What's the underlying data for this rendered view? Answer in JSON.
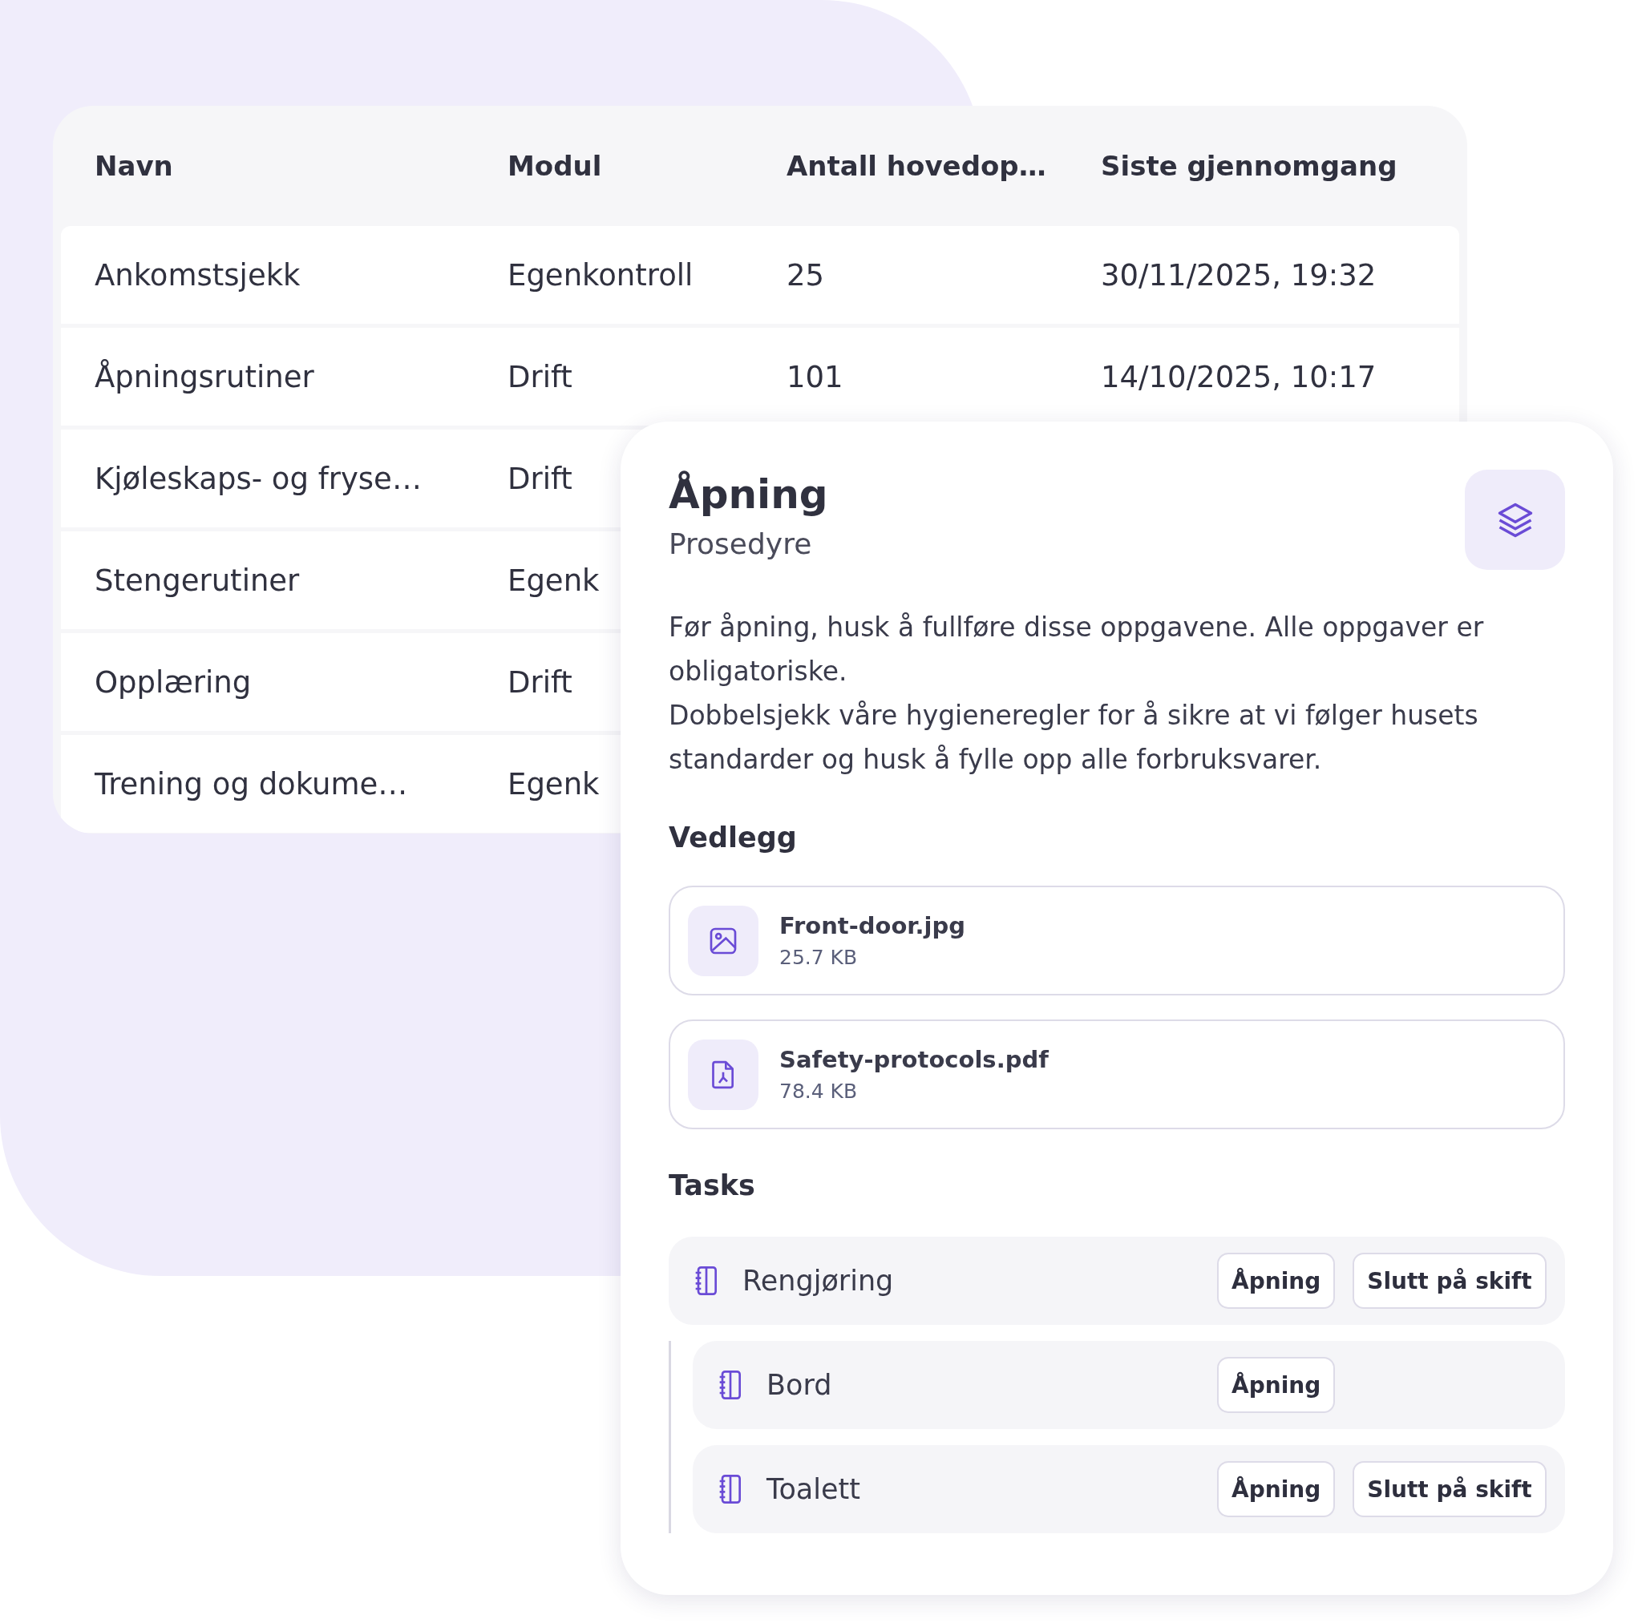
{
  "table": {
    "columns": [
      "Navn",
      "Modul",
      "Antall hovedop…",
      "Siste gjennomgang"
    ],
    "rows": [
      {
        "cells": [
          "Ankomstsjekk",
          "Egenkontroll",
          "25",
          "30/11/2025, 19:32"
        ]
      },
      {
        "cells": [
          "Åpningsrutiner",
          "Drift",
          "101",
          "14/10/2025, 10:17"
        ]
      },
      {
        "cells": [
          "Kjøleskaps- og fryse…",
          "Drift"
        ]
      },
      {
        "cells": [
          "Stengerutiner",
          "Egenk"
        ]
      },
      {
        "cells": [
          "Opplæring",
          "Drift"
        ]
      },
      {
        "cells": [
          "Trening og dokume…",
          "Egenk"
        ]
      }
    ]
  },
  "detail": {
    "title": "Åpning",
    "subtitle": "Prosedyre",
    "description": [
      "Før åpning, husk å fullføre disse oppgavene. Alle oppgaver er obligatoriske.",
      "Dobbelsjekk våre hygieneregler for å sikre at vi følger husets standarder og husk å fylle opp alle forbruksvarer."
    ],
    "attachments_heading": "Vedlegg",
    "attachments": [
      {
        "kind": "image",
        "name": "Front-door.jpg",
        "size": "25.7 KB"
      },
      {
        "kind": "pdf",
        "name": "Safety-protocols.pdf",
        "size": "78.4 KB"
      }
    ],
    "tasks_heading": "Tasks",
    "tasks": [
      {
        "name": "Rengjøring",
        "tags": [
          "Åpning",
          "Slutt på skift"
        ],
        "children": [
          {
            "name": "Bord",
            "tags": [
              "Åpning"
            ]
          },
          {
            "name": "Toalett",
            "tags": [
              "Åpning",
              "Slutt på skift"
            ]
          }
        ]
      }
    ]
  }
}
